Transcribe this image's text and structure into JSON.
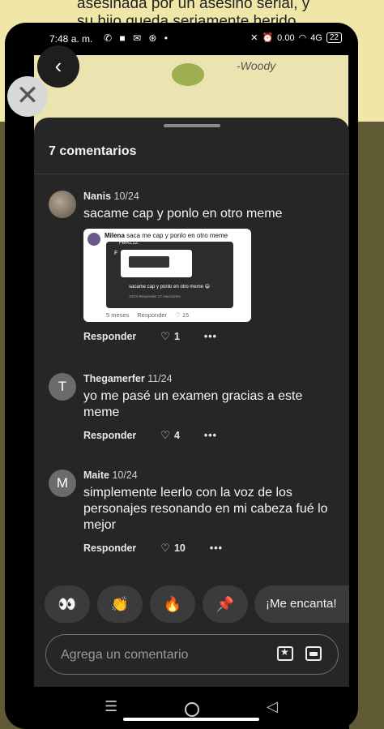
{
  "background": {
    "caption_line1": "asesinada por un asesino serial, y",
    "caption_line2": "su hijo queda seriamente herido",
    "signature": "-Woody"
  },
  "status_bar": {
    "time": "7:48 a. m.",
    "left_icons": "✆ ■ ✉ ⊛ •",
    "net_speed": "0.00",
    "network": "4G",
    "battery": "22"
  },
  "overlay": {
    "close_icon": "close-icon",
    "back_icon": "chevron-left-icon"
  },
  "sheet": {
    "title": "7 comentarios"
  },
  "comments": [
    {
      "user": "Nanis",
      "date": "10/24",
      "text": "sacame cap y ponlo en otro meme",
      "reply_label": "Responder",
      "likes": "1",
      "embed": {
        "user": "Milena",
        "text": "saca me cap y ponlo en otro meme",
        "inner_user": "FerKL12.",
        "inner_initial": "F",
        "inner_reply": "sacame cap y ponlo en otro meme 😄",
        "inner_meta": "10/24     Responder     17 reacciones",
        "age": "5 meses",
        "reply_label": "Responder",
        "likes": "15"
      }
    },
    {
      "initial": "T",
      "user": "Thegamerfer",
      "date": "11/24",
      "text": "yo me pasé un examen gracias a este meme",
      "reply_label": "Responder",
      "likes": "4"
    },
    {
      "initial": "M",
      "user": "Maite",
      "date": "10/24",
      "text": "simplemente leerlo con la voz de los personajes resonando en mi cabeza fué lo mejor",
      "reply_label": "Responder",
      "likes": "10"
    }
  ],
  "reactions": [
    "👀",
    "👏",
    "🔥",
    "📌"
  ],
  "reaction_text": "¡Me encanta!",
  "comment_input": {
    "placeholder": "Agrega un comentario"
  },
  "colors": {
    "sheet_bg": "#262626",
    "chip_bg": "#3b3b3b",
    "text": "#f2f2f2"
  }
}
